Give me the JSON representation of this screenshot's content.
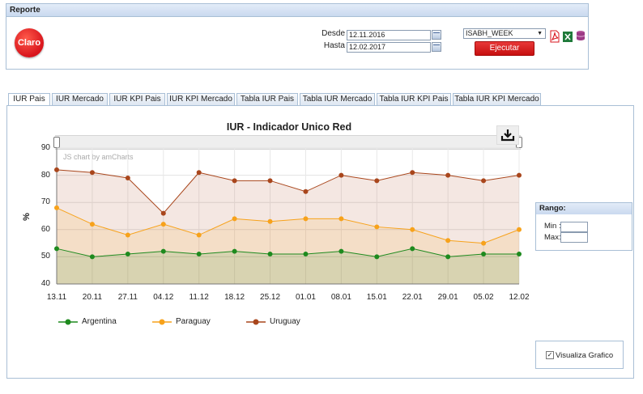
{
  "report": {
    "title": "Reporte",
    "logo_text": "Claro",
    "desde_label": "Desde",
    "desde_value": "12.11.2016",
    "hasta_label": "Hasta",
    "hasta_value": "12.02.2017",
    "week_select": "ISABH_WEEK",
    "run_label": "Ejecutar",
    "export_icons": [
      "pdf-icon",
      "excel-icon",
      "database-export-icon"
    ]
  },
  "tabs": [
    {
      "label": "IUR Pais",
      "active": true
    },
    {
      "label": "IUR Mercado",
      "active": false
    },
    {
      "label": "IUR KPI Pais",
      "active": false
    },
    {
      "label": "IUR KPI Mercado",
      "active": false
    },
    {
      "label": "Tabla IUR Pais",
      "active": false
    },
    {
      "label": "Tabla IUR Mercado",
      "active": false
    },
    {
      "label": "Tabla IUR KPI Pais",
      "active": false
    },
    {
      "label": "Tabla IUR KPI Mercado",
      "active": false
    }
  ],
  "chart_credits": "JS chart by amCharts",
  "range": {
    "title": "Rango:",
    "min_label": "Min :",
    "max_label": "Max:"
  },
  "visualiza": {
    "label": "Visualiza Grafico",
    "checked": true
  },
  "colors": {
    "argentina": "#1e8a1e",
    "paraguay": "#f7a21b",
    "uruguay": "#a9461c",
    "accent": "#d8141c"
  },
  "chart_data": {
    "type": "area",
    "title": "IUR - Indicador Unico Red",
    "ylabel": "%",
    "xlabel": "",
    "ylim": [
      40,
      90
    ],
    "yticks": [
      40,
      50,
      60,
      70,
      80,
      90
    ],
    "grid": true,
    "legend_position": "bottom",
    "categories": [
      "13.11",
      "20.11",
      "27.11",
      "04.12",
      "11.12",
      "18.12",
      "25.12",
      "01.01",
      "08.01",
      "15.01",
      "22.01",
      "29.01",
      "05.02",
      "12.02"
    ],
    "series": [
      {
        "name": "Argentina",
        "color": "#1e8a1e",
        "values": [
          53,
          50,
          51,
          52,
          51,
          52,
          51,
          51,
          52,
          50,
          53,
          50,
          51,
          51
        ]
      },
      {
        "name": "Paraguay",
        "color": "#f7a21b",
        "values": [
          68,
          62,
          58,
          62,
          58,
          64,
          63,
          64,
          64,
          61,
          60,
          56,
          55,
          60
        ]
      },
      {
        "name": "Uruguay",
        "color": "#a9461c",
        "values": [
          82,
          81,
          79,
          66,
          81,
          78,
          78,
          74,
          80,
          78,
          81,
          80,
          78,
          80
        ]
      }
    ]
  }
}
